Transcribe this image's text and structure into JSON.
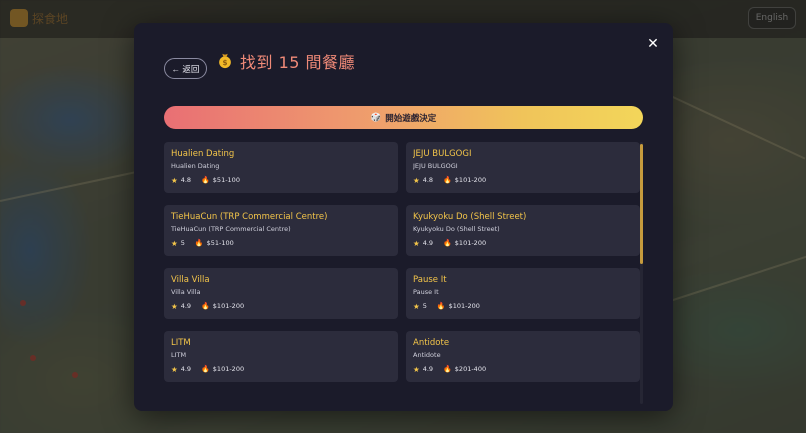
{
  "background": {
    "top_title": "探食地",
    "lang_button": "English"
  },
  "modal": {
    "close_label": "✕",
    "back_label": "← 返回",
    "title": "找到 15 間餐廳",
    "start_button": "開始遊戲決定",
    "start_icon": "🎲"
  },
  "restaurants": [
    {
      "name": "Hualien Dating",
      "sub": "Hualien Dating",
      "rating": "4.8",
      "price": "$51-100"
    },
    {
      "name": "JEJU BULGOGI",
      "sub": "JEJU BULGOGI",
      "rating": "4.8",
      "price": "$101-200"
    },
    {
      "name": "TieHuaCun (TRP Commercial Centre)",
      "sub": "TieHuaCun (TRP Commercial Centre)",
      "rating": "5",
      "price": "$51-100"
    },
    {
      "name": "Kyukyoku Do (Shell Street)",
      "sub": "Kyukyoku Do (Shell Street)",
      "rating": "4.9",
      "price": "$101-200"
    },
    {
      "name": "Villa Villa",
      "sub": "Villa Villa",
      "rating": "4.9",
      "price": "$101-200"
    },
    {
      "name": "Pause It",
      "sub": "Pause It",
      "rating": "5",
      "price": "$101-200"
    },
    {
      "name": "LITM",
      "sub": "LITM",
      "rating": "4.9",
      "price": "$101-200"
    },
    {
      "name": "Antidote",
      "sub": "Antidote",
      "rating": "4.9",
      "price": "$201-400"
    }
  ],
  "colors": {
    "accent_title": "#f08a78",
    "card_name": "#f3c54a",
    "modal_bg": "#1b1b2a",
    "card_bg": "#2c2c3c"
  },
  "icons": {
    "star": "star-icon",
    "price": "flame-icon",
    "title": "money-bag-icon"
  }
}
